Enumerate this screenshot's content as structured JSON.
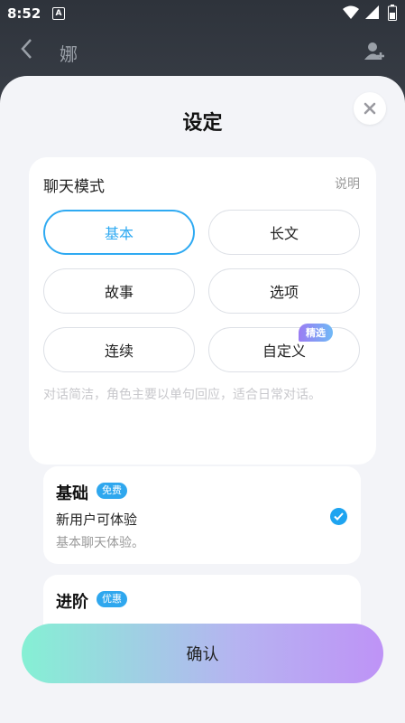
{
  "status": {
    "time": "8:52",
    "notif_icon": "A"
  },
  "topbar": {
    "name": "娜"
  },
  "sheet": {
    "title": "设定",
    "chat_mode": {
      "label": "聊天模式",
      "explain": "说明",
      "modes": [
        "基本",
        "长文",
        "故事",
        "选项",
        "连续",
        "自定义"
      ],
      "selected": "基本",
      "pick_badge": "精选",
      "description": "对话简洁，角色主要以单句回应，适合日常对话。"
    },
    "tiers": [
      {
        "title": "基础",
        "tag": "免费",
        "line1": "新用户可体验",
        "line2": "基本聊天体验。",
        "checked": true
      },
      {
        "title": "进阶",
        "tag": "优惠"
      }
    ],
    "confirm": "确认"
  },
  "colors": {
    "accent": "#2faaf2",
    "check": "#1ea4f0"
  }
}
